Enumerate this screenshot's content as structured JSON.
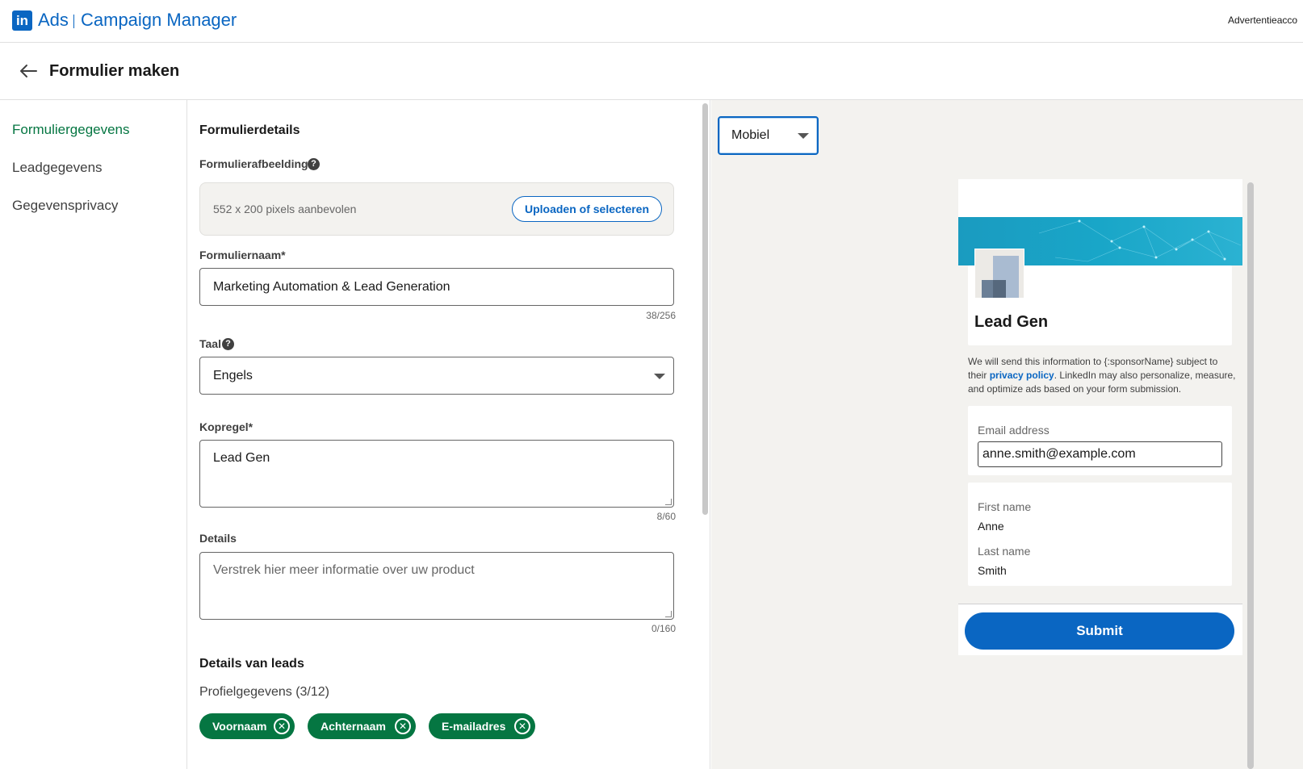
{
  "header": {
    "logo_text": "in",
    "brand_ads": "Ads",
    "brand_product": "Campaign Manager",
    "account_label": "Advertentieacco"
  },
  "page": {
    "title": "Formulier maken"
  },
  "sidebar": {
    "items": [
      {
        "label": "Formuliergegevens",
        "active": true
      },
      {
        "label": "Leadgegevens",
        "active": false
      },
      {
        "label": "Gegevensprivacy",
        "active": false
      }
    ]
  },
  "form": {
    "section_title": "Formulierdetails",
    "image": {
      "label": "Formulierafbeelding",
      "hint": "552 x 200 pixels aanbevolen",
      "button_label": "Uploaden of selecteren"
    },
    "name": {
      "label": "Formuliernaam*",
      "value": "Marketing Automation & Lead Generation",
      "counter": "38/256"
    },
    "language": {
      "label": "Taal",
      "value": "Engels"
    },
    "headline": {
      "label": "Kopregel*",
      "value": "Lead Gen",
      "counter": "8/60"
    },
    "details": {
      "label": "Details",
      "placeholder": "Verstrek hier meer informatie over uw product",
      "counter": "0/160"
    },
    "lead_details": {
      "title": "Details van leads",
      "profile_title": "Profielgegevens (3/12)",
      "chips": [
        "Voornaam",
        "Achternaam",
        "E-mailadres"
      ]
    }
  },
  "preview": {
    "device": "Mobiel",
    "headline": "Lead Gen",
    "privacy_before": "We will send this information to {:sponsorName} subject to their ",
    "privacy_link": "privacy policy",
    "privacy_after": ". LinkedIn may also personalize, measure, and optimize ads based on your form submission.",
    "email_label": "Email address",
    "email_value": "anne.smith@example.com",
    "first_name_label": "First name",
    "first_name_value": "Anne",
    "last_name_label": "Last name",
    "last_name_value": "Smith",
    "submit_label": "Submit"
  },
  "colors": {
    "brand_blue": "#0a66c2",
    "active_green": "#057642",
    "preview_bg": "#f3f2ef"
  }
}
